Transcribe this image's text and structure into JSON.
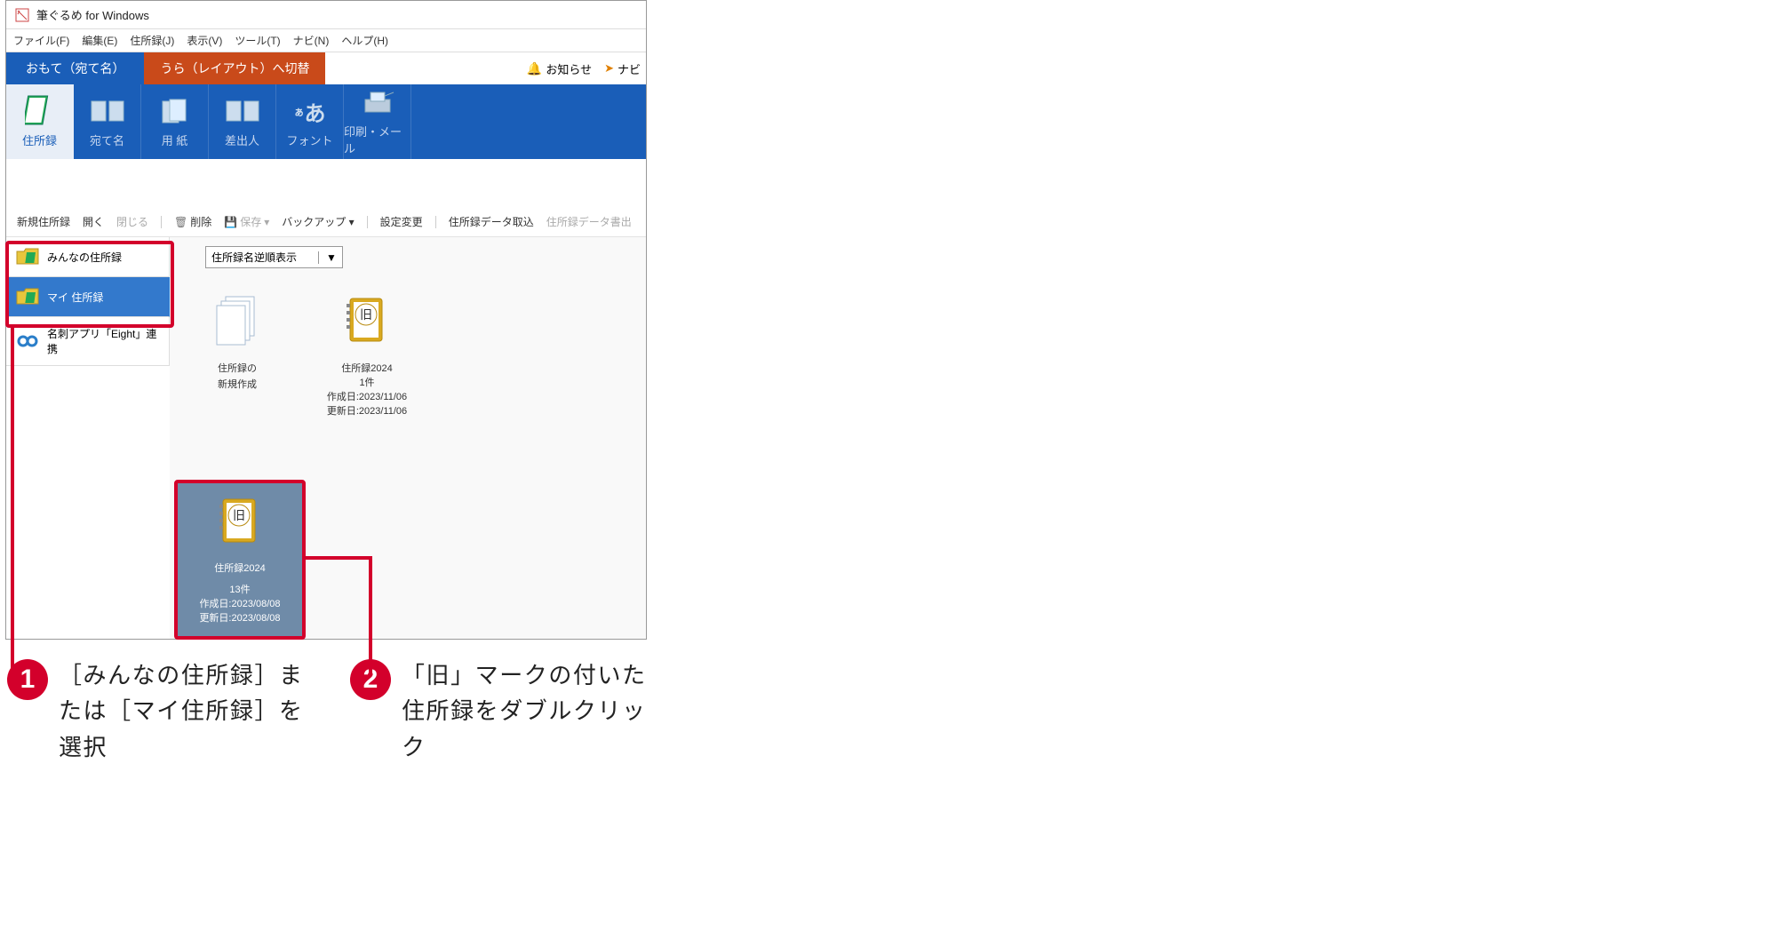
{
  "window": {
    "title": "筆ぐるめ for Windows"
  },
  "menu": {
    "file": "ファイル(F)",
    "edit": "編集(E)",
    "addressbook": "住所録(J)",
    "view": "表示(V)",
    "tools": "ツール(T)",
    "navi": "ナビ(N)",
    "help": "ヘルプ(H)"
  },
  "tabs": {
    "omote": "おもて（宛て名）",
    "ura": "うら（レイアウト）へ切替"
  },
  "topright": {
    "notice": "お知らせ",
    "navi": "ナビ"
  },
  "ribbon": {
    "addressbook": "住所録",
    "atena": "宛て名",
    "paper": "用 紙",
    "sender": "差出人",
    "font": "フォント",
    "print": "印刷・メール",
    "fontchar": "あ"
  },
  "toolbar": {
    "new": "新規住所録",
    "open": "開く",
    "close": "閉じる",
    "delete": "削除",
    "save": "保存",
    "backup": "バックアップ",
    "settings": "設定変更",
    "import": "住所録データ取込",
    "export": "住所録データ書出"
  },
  "sidebar": {
    "everyone": "みんなの住所録",
    "mine": "マイ 住所録",
    "eight": "名刺アプリ「Eight」連携"
  },
  "sort": {
    "label": "住所録名逆順表示"
  },
  "cards": {
    "new": {
      "title": "住所録の",
      "title2": "新規作成"
    },
    "book2024": {
      "badge": "旧",
      "title": "住所録2024",
      "count": "1件",
      "created": "作成日:2023/11/06",
      "updated": "更新日:2023/11/06"
    },
    "selected": {
      "badge": "旧",
      "title": "住所録2024",
      "count": "13件",
      "created": "作成日:2023/08/08",
      "updated": "更新日:2023/08/08"
    }
  },
  "annotations": {
    "one": {
      "num": "1",
      "text": "［みんなの住所録］または［マイ住所録］を選択"
    },
    "two": {
      "num": "2",
      "text": "「旧」マークの付いた住所録をダブルクリック"
    }
  }
}
